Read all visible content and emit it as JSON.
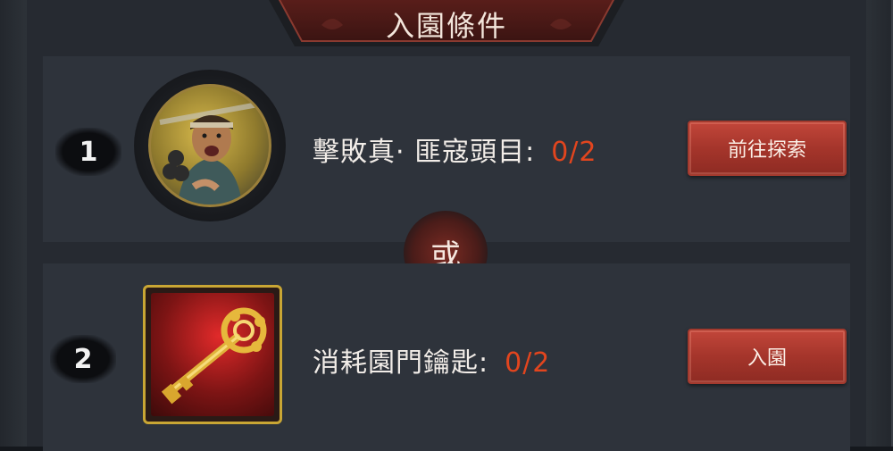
{
  "header": {
    "title": "入園條件"
  },
  "conditions": [
    {
      "number": "1",
      "portrait_icon": "bandit-leader-portrait-icon",
      "label": "擊敗真· 匪寇頭目:",
      "progress": "0/2",
      "button_label": "前往探索"
    },
    {
      "number": "2",
      "portrait_icon": "golden-key-icon",
      "label": "消耗園門鑰匙:",
      "progress": "0/2",
      "button_label": "入園"
    }
  ],
  "separator": {
    "label": "或"
  },
  "colors": {
    "progress": "#e2451e",
    "button": "#a5352b",
    "item_frame": "#c9a634",
    "background": "#262a31"
  }
}
